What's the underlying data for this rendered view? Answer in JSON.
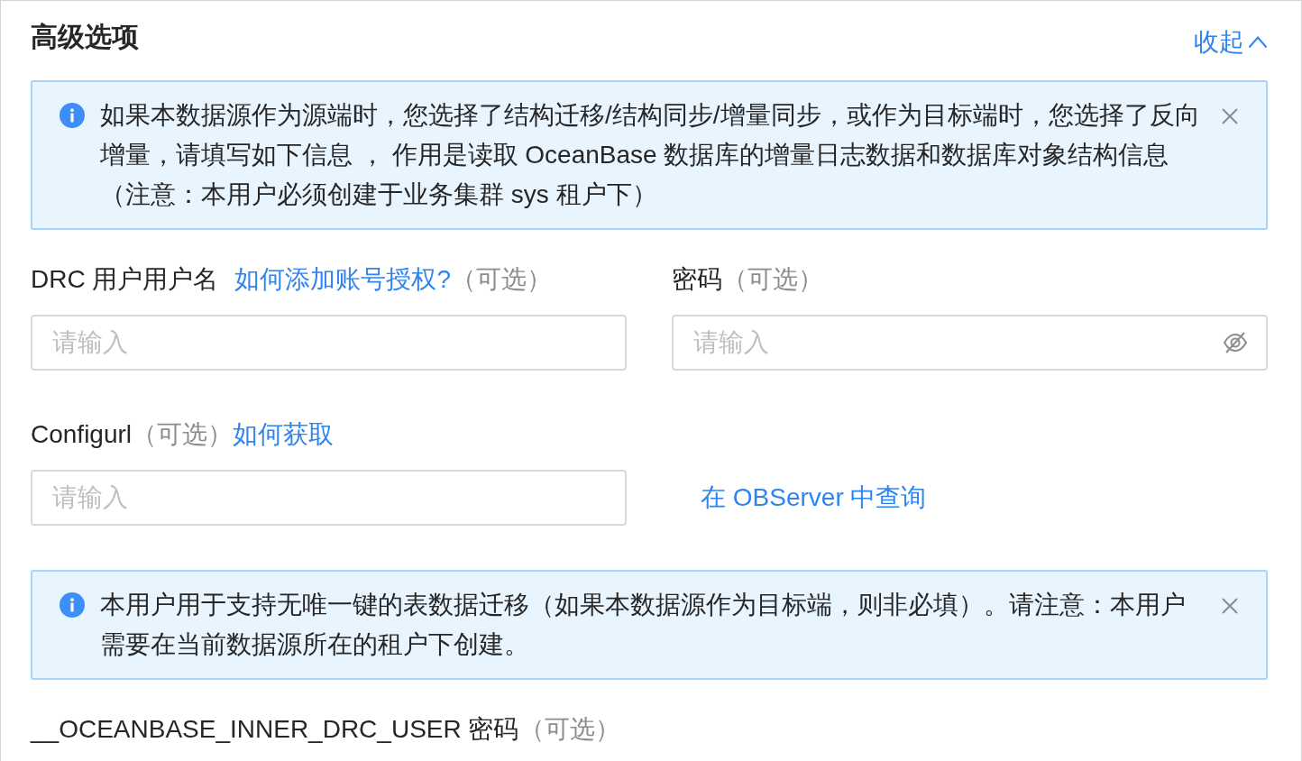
{
  "header": {
    "title": "高级选项",
    "collapse_link": "收起"
  },
  "content": [
    {
      "kind": "alert",
      "text": "如果本数据源作为源端时，您选择了结构迁移/结构同步/增量同步，或作为目标端时，您选择了反向增量，请填写如下信息 ， 作用是读取 OceanBase 数据库的增量日志数据和数据库对象结构信息（注意：本用户必须创建于业务集群 sys 租户下）",
      "closable": true
    },
    {
      "kind": "row",
      "items": [
        {
          "kind": "field",
          "label_parts": [
            {
              "kind": "text",
              "text": "DRC 用户用户名"
            },
            {
              "kind": "link",
              "text": "如何添加账号授权?"
            },
            {
              "kind": "hint",
              "text": "（可选）"
            }
          ],
          "input": {
            "kind": "text",
            "placeholder": "请输入"
          }
        },
        {
          "kind": "field",
          "label_parts": [
            {
              "kind": "text",
              "text": "密码"
            },
            {
              "kind": "hint",
              "text": "（可选）"
            }
          ],
          "input": {
            "kind": "password",
            "placeholder": "请输入"
          }
        }
      ]
    },
    {
      "kind": "row",
      "items": [
        {
          "kind": "field",
          "label_parts": [
            {
              "kind": "text",
              "text": "Configurl"
            },
            {
              "kind": "hint",
              "text": "（可选）"
            },
            {
              "kind": "link",
              "text": "如何获取"
            }
          ],
          "input": {
            "kind": "text",
            "placeholder": "请输入"
          }
        },
        {
          "kind": "link",
          "text": "在 OBServer 中查询"
        }
      ]
    },
    {
      "kind": "alert",
      "text": "本用户用于支持无唯一键的表数据迁移（如果本数据源作为目标端，则非必填）。请注意：本用户需要在当前数据源所在的租户下创建。",
      "closable": true
    },
    {
      "kind": "row",
      "items": [
        {
          "kind": "field",
          "label_parts": [
            {
              "kind": "text",
              "text": "__OCEANBASE_INNER_DRC_USER 密码"
            },
            {
              "kind": "hint",
              "text": "（可选）"
            }
          ]
        }
      ]
    }
  ]
}
